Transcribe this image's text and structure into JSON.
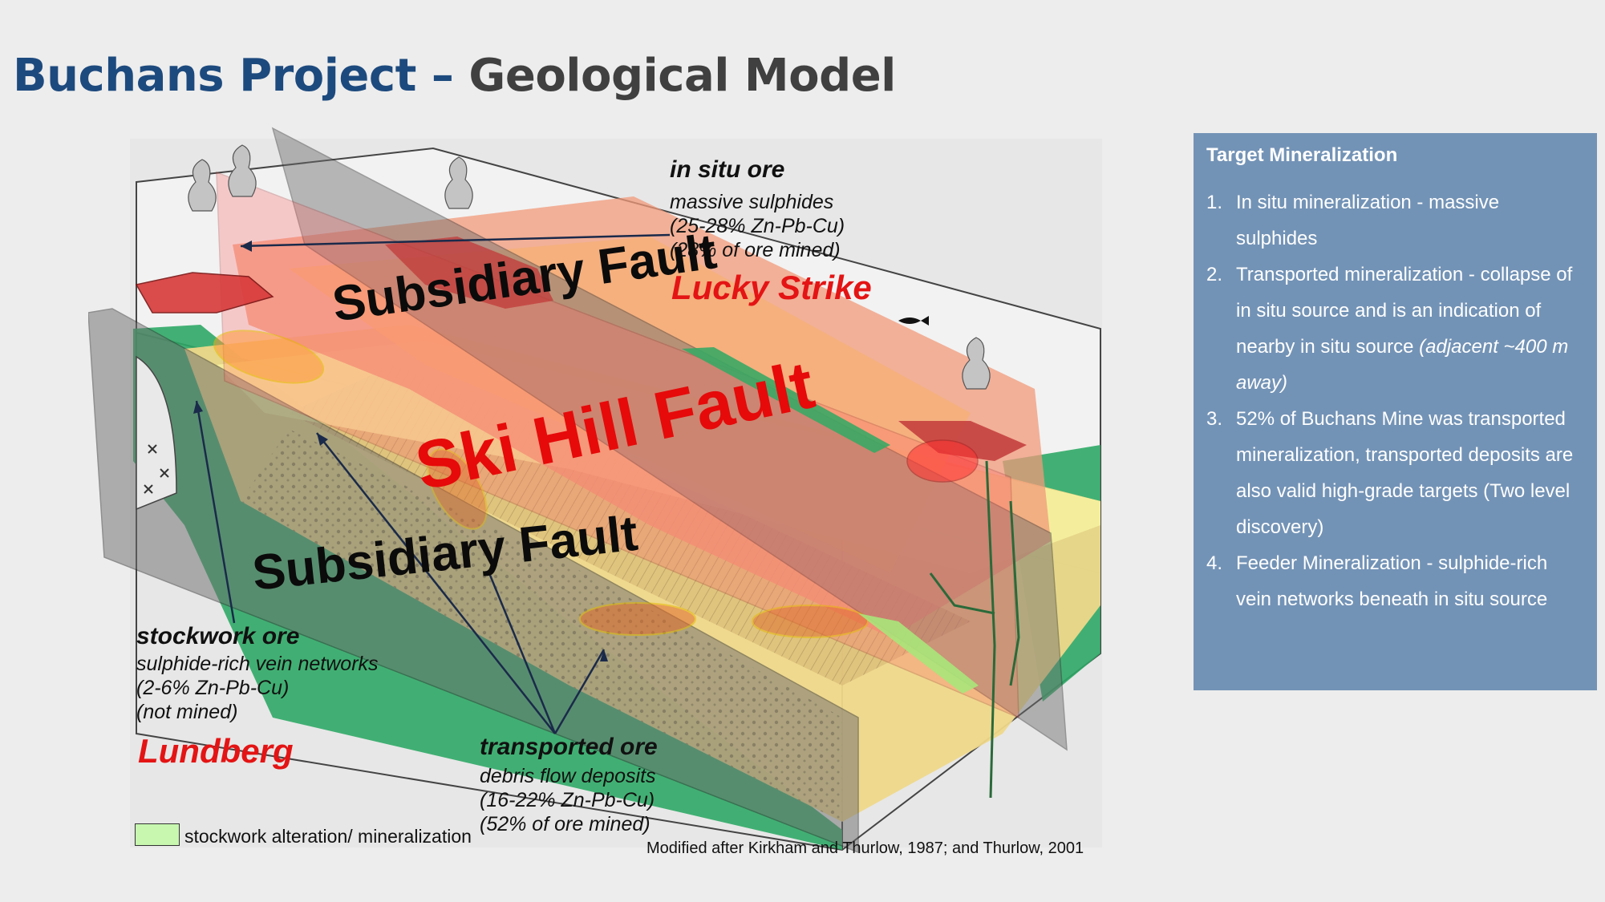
{
  "title": {
    "part1": "Buchans Project",
    "sep": " – ",
    "part2": "Geological Model"
  },
  "diagram": {
    "in_situ": {
      "head": "in situ ore",
      "line1": "massive sulphides",
      "line2": "(25-28% Zn-Pb-Cu)",
      "line3": "(28% of ore mined)"
    },
    "lucky_strike": "Lucky Strike",
    "fault_top": "Subsidiary Fault",
    "fault_main": "Ski Hill Fault",
    "fault_bottom": "Subsidiary Fault",
    "stockwork": {
      "head": "stockwork ore",
      "line1": "sulphide-rich vein networks",
      "line2": "(2-6% Zn-Pb-Cu)",
      "line3": "(not mined)"
    },
    "lundberg": "Lundberg",
    "transported": {
      "head": "transported ore",
      "line1": "debris flow deposits",
      "line2": "(16-22% Zn-Pb-Cu)",
      "line3": "(52% of ore mined)"
    },
    "legend_label": "stockwork alteration/ mineralization",
    "credit": "Modified after Kirkham and Thurlow, 1987; and Thurlow, 2001"
  },
  "panel": {
    "title": "Target Mineralization",
    "items": [
      {
        "num": "1.",
        "text": "In situ mineralization - massive sulphides",
        "italic": ""
      },
      {
        "num": "2.",
        "text": "Transported mineralization - collapse of in situ source and is an indication of nearby in situ source ",
        "italic": "(adjacent ~400 m away)"
      },
      {
        "num": "3.",
        "text": "52% of Buchans Mine was transported mineralization, transported deposits are also valid high-grade targets (Two level discovery)",
        "italic": ""
      },
      {
        "num": "4.",
        "text": "Feeder Mineralization -  sulphide-rich vein networks  beneath in situ source",
        "italic": ""
      }
    ]
  },
  "colors": {
    "title_blue": "#1d4a7e",
    "title_grey": "#404040",
    "panel_bg": "#7393b6",
    "fault_red": "#e60a0a",
    "label_red": "#e41414"
  }
}
